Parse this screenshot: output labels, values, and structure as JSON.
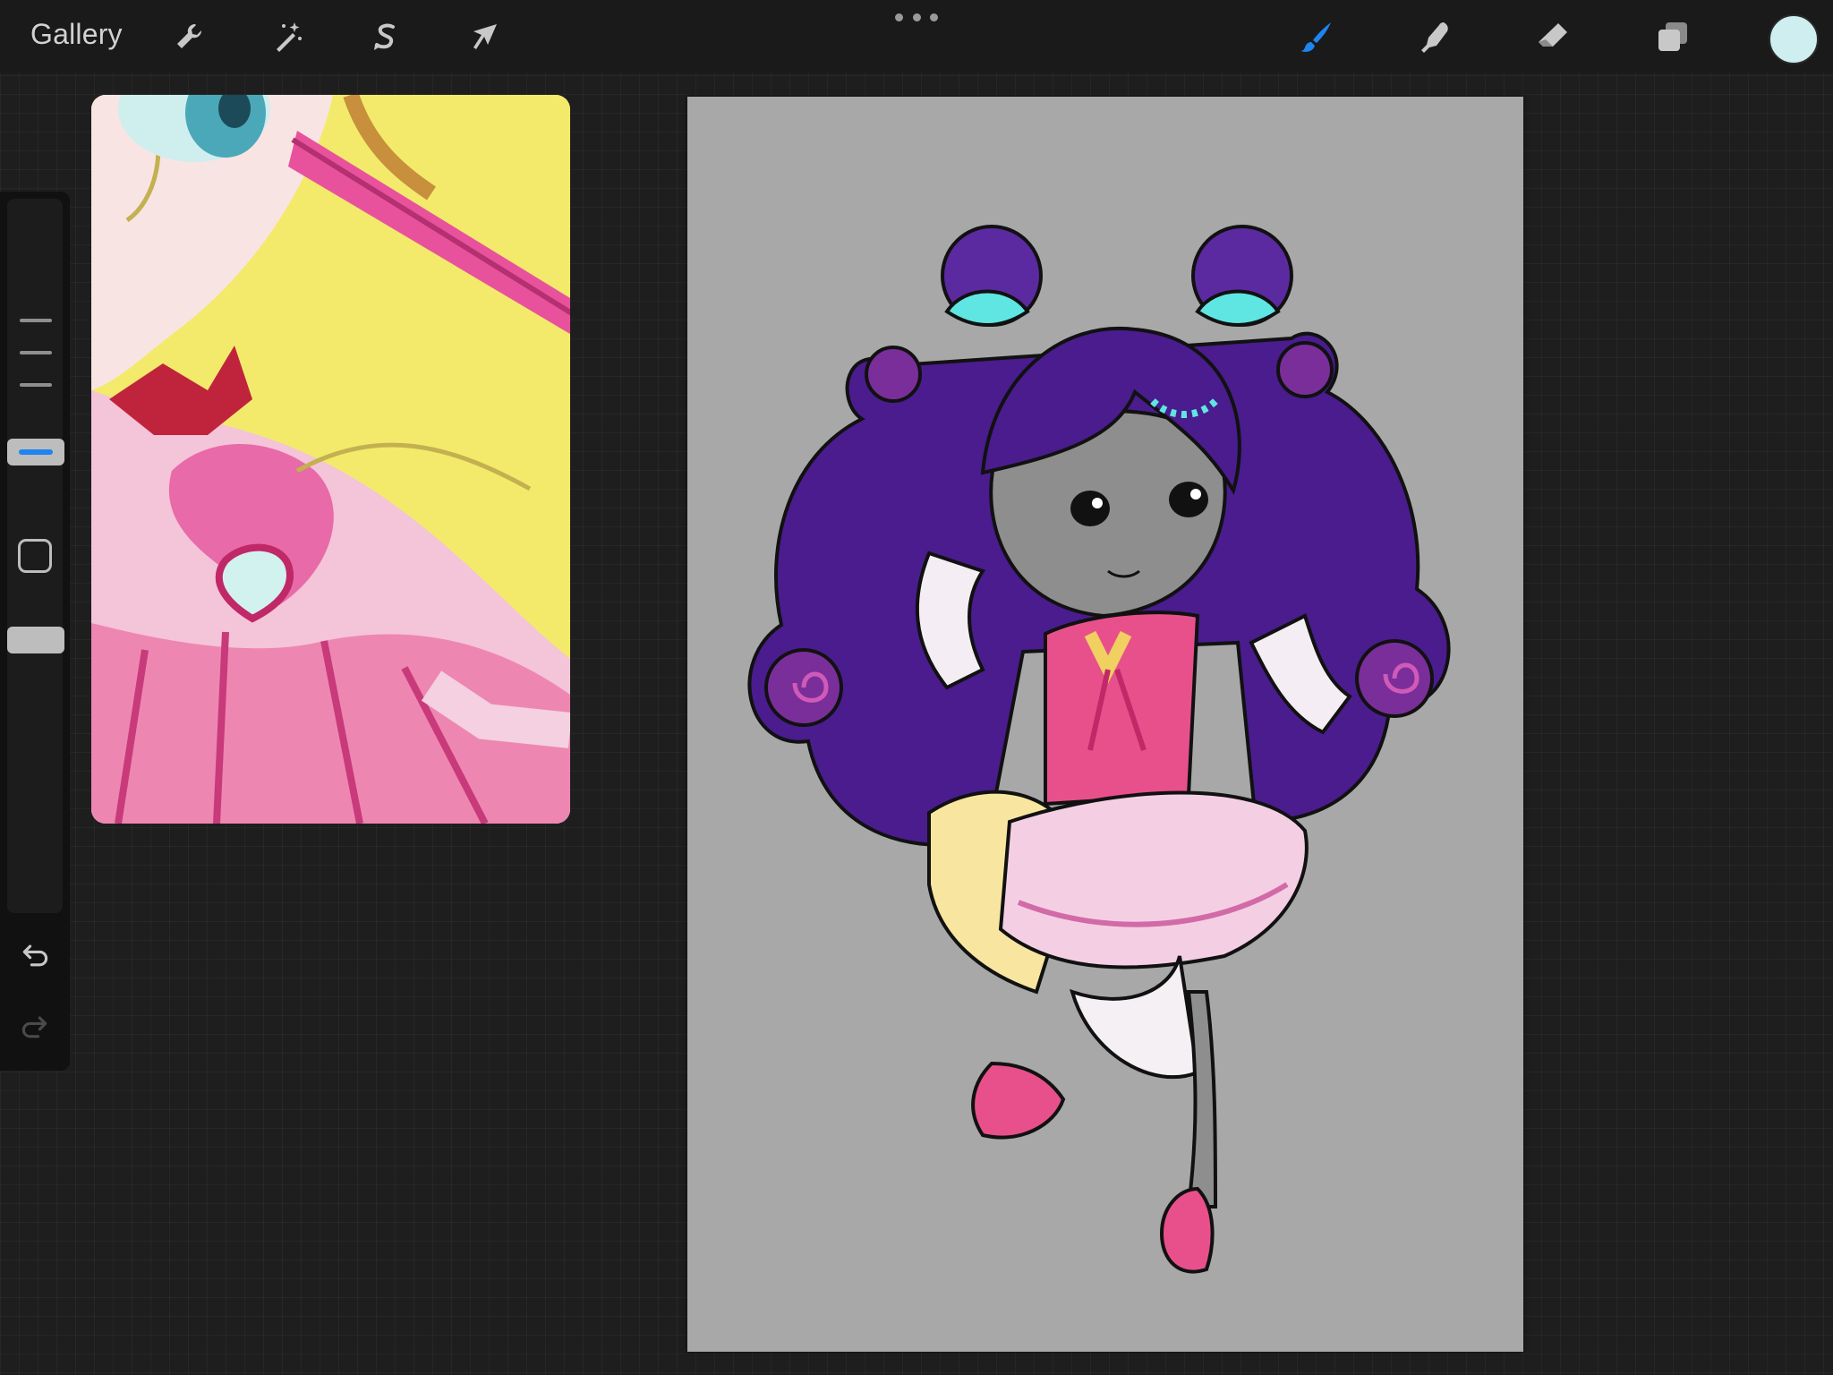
{
  "toolbar": {
    "gallery_label": "Gallery",
    "actions_icon": "wrench-icon",
    "adjustments_icon": "magic-wand-icon",
    "selection_icon": "selection-s-icon",
    "transform_icon": "arrow-cursor-icon",
    "more_icon": "ellipsis-icon",
    "brush_icon": "brush-icon",
    "smudge_icon": "smudge-finger-icon",
    "eraser_icon": "eraser-icon",
    "layers_icon": "layers-icon",
    "active_tool": "brush",
    "current_color": "#cfeef0",
    "accent_color": "#1e84f0"
  },
  "sidebar": {
    "brush_size_icon": "brush-size-slider",
    "modify_button_icon": "square-icon",
    "opacity_icon": "opacity-slider",
    "undo_icon": "undo-icon",
    "redo_icon": "redo-icon"
  },
  "reference_window": {
    "icon": "reference-image"
  },
  "canvas": {
    "background_color": "#a8a8a8",
    "icon": "chibi-character-artwork"
  }
}
